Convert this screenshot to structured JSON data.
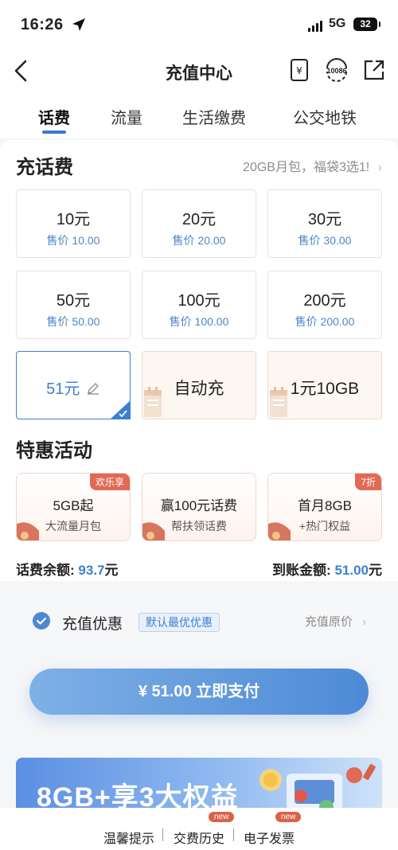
{
  "status": {
    "time": "16:26",
    "network": "5G",
    "battery": "32"
  },
  "nav": {
    "title": "充值中心",
    "icons": [
      "back-icon",
      "bill-icon",
      "10086-service-icon",
      "share-icon"
    ],
    "service_label": "10086"
  },
  "tabs": [
    {
      "label": "话费",
      "active": true
    },
    {
      "label": "流量",
      "active": false
    },
    {
      "label": "生活缴费",
      "active": false
    },
    {
      "label": "公交地铁",
      "active": false
    }
  ],
  "recharge": {
    "title": "充话费",
    "promo": "20GB月包，福袋3选1!",
    "options": [
      {
        "amount": "10元",
        "price": "售价 10.00"
      },
      {
        "amount": "20元",
        "price": "售价 20.00"
      },
      {
        "amount": "30元",
        "price": "售价 30.00"
      },
      {
        "amount": "50元",
        "price": "售价 50.00"
      },
      {
        "amount": "100元",
        "price": "售价 100.00"
      },
      {
        "amount": "200元",
        "price": "售价 200.00"
      }
    ],
    "custom_amount": "51元",
    "auto_recharge": "自动充",
    "data_option": "1元10GB"
  },
  "activities": {
    "title": "特惠活动",
    "items": [
      {
        "title": "5GB起",
        "subtitle": "大流量月包",
        "badge": "欢乐享"
      },
      {
        "title": "赢100元话费",
        "subtitle": "帮扶领话费",
        "badge": ""
      },
      {
        "title": "首月8GB",
        "subtitle": "+热门权益",
        "badge": "7折"
      }
    ]
  },
  "balance": {
    "label": "话费余额:",
    "value": "93.7",
    "unit": "元"
  },
  "arrival": {
    "label": "到账金额:",
    "value": "51.00",
    "unit": "元"
  },
  "discount": {
    "label": "充值优惠",
    "tag": "默认最优优惠",
    "right": "充值原价"
  },
  "pay_button": "¥ 51.00 立即支付",
  "banner": {
    "text": "8GB+享3大权益"
  },
  "footer": {
    "links": [
      "温馨提示",
      "交费历史",
      "电子发票"
    ],
    "new_badge": "new"
  },
  "colors": {
    "accent": "#3d7fd0",
    "badge": "#e06a55",
    "pay_gradient_start": "#7fb0e6",
    "pay_gradient_end": "#4d8ad6"
  }
}
